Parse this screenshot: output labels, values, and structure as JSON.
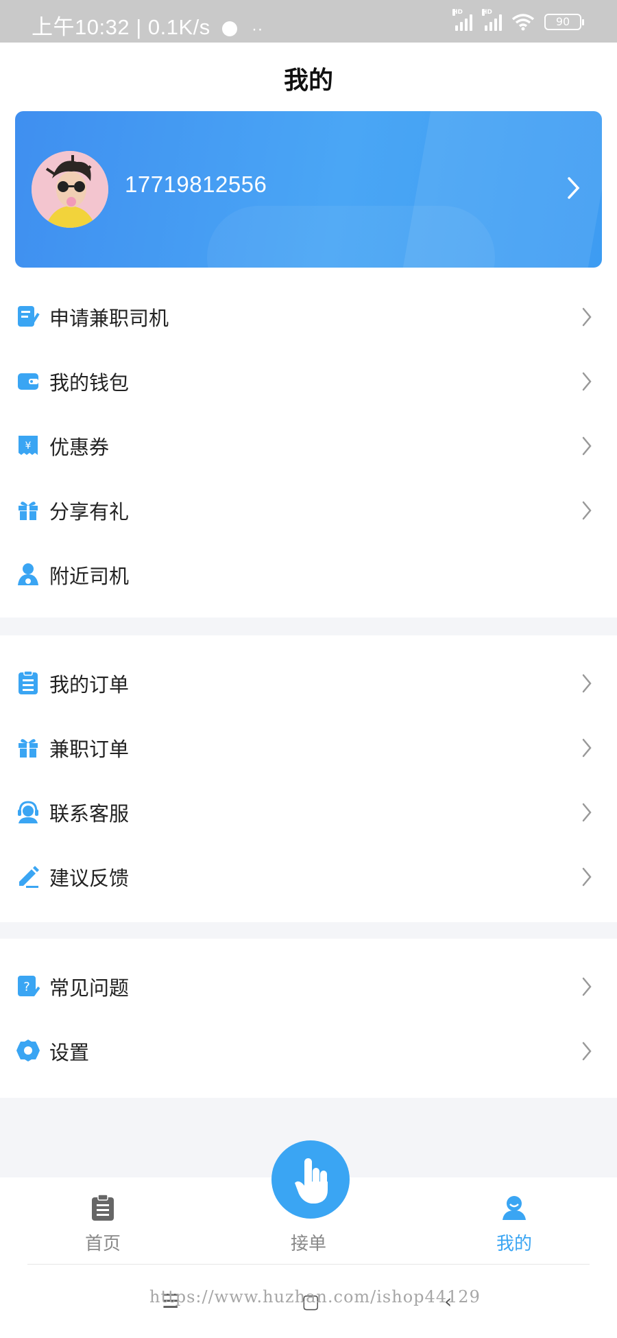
{
  "status_bar": {
    "time_speed": "上午10:32 | 0.1K/s",
    "extra": "··",
    "signal_label": "HD",
    "battery": "90"
  },
  "header": {
    "title": "我的"
  },
  "profile": {
    "phone": "17719812556"
  },
  "menu_group_1": [
    {
      "label": "申请兼职司机",
      "icon": "apply-edit-icon",
      "arrow": true
    },
    {
      "label": "我的钱包",
      "icon": "wallet-icon",
      "arrow": true
    },
    {
      "label": "优惠券",
      "icon": "coupon-icon",
      "arrow": true
    },
    {
      "label": "分享有礼",
      "icon": "gift-icon",
      "arrow": true
    },
    {
      "label": "附近司机",
      "icon": "driver-icon",
      "arrow": false
    }
  ],
  "menu_group_2": [
    {
      "label": "我的订单",
      "icon": "order-list-icon",
      "arrow": true
    },
    {
      "label": "兼职订单",
      "icon": "gift-icon",
      "arrow": true
    },
    {
      "label": "联系客服",
      "icon": "customer-service-icon",
      "arrow": true
    },
    {
      "label": "建议反馈",
      "icon": "feedback-edit-icon",
      "arrow": true
    }
  ],
  "menu_group_3": [
    {
      "label": "常见问题",
      "icon": "faq-icon",
      "arrow": true
    },
    {
      "label": "设置",
      "icon": "settings-gear-icon",
      "arrow": true
    }
  ],
  "tabs": {
    "home": "首页",
    "accept": "接单",
    "mine": "我的"
  },
  "colors": {
    "accent": "#3aa5f3",
    "active_tab": "#3aa5f3"
  },
  "watermark": "https://www.huzhan.com/ishop44129"
}
